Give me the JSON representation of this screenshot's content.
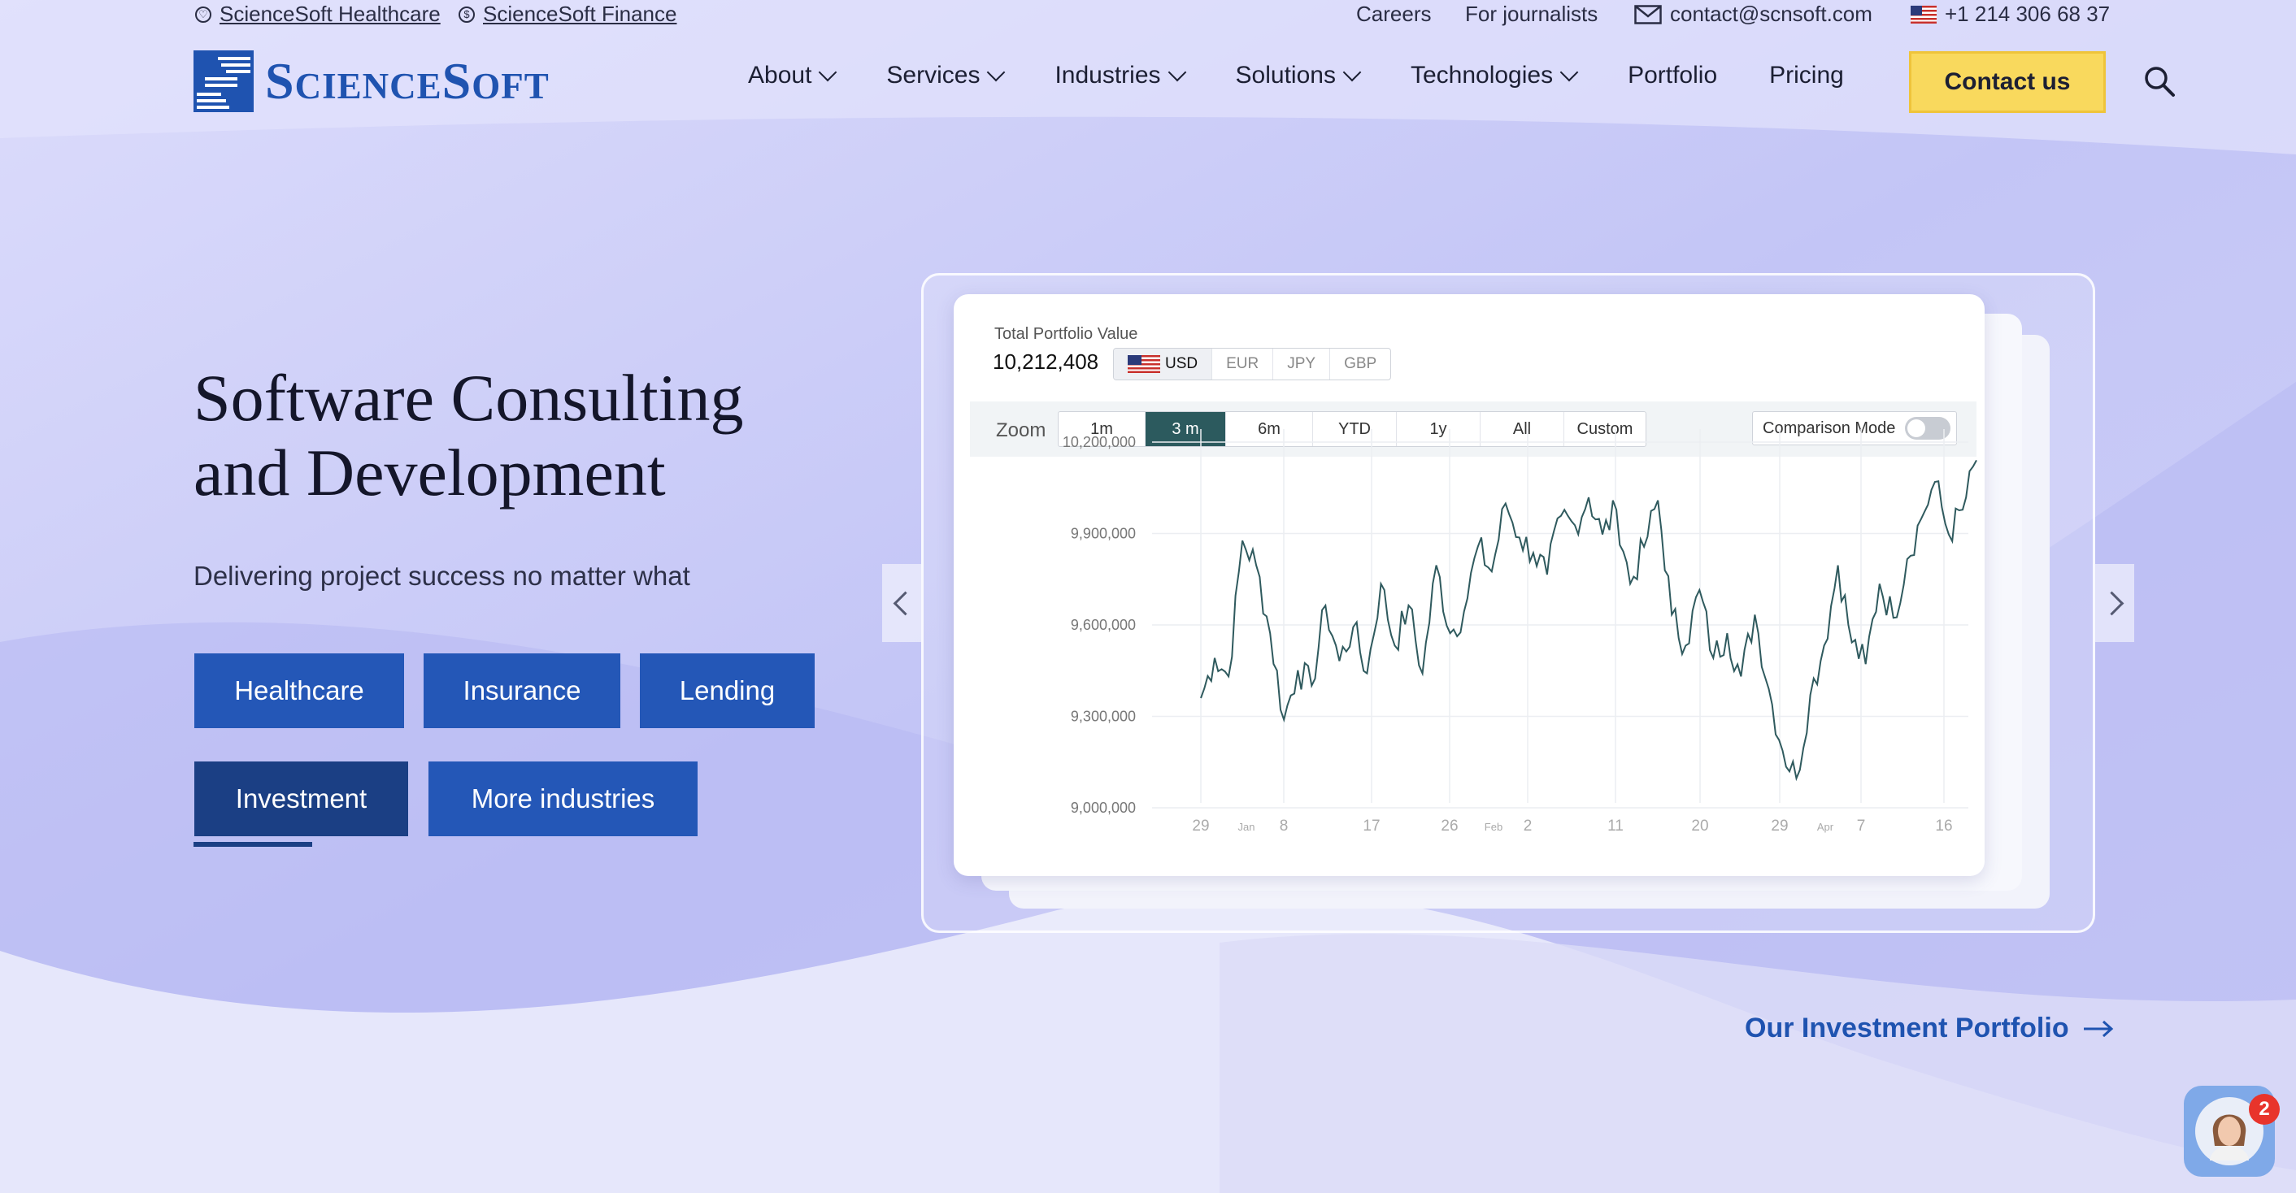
{
  "topbar": {
    "healthcare_link": "ScienceSoft Healthcare",
    "finance_link": "ScienceSoft Finance",
    "careers": "Careers",
    "journalists": "For journalists",
    "email": "contact@scnsoft.com",
    "phone": "+1 214 306 68 37"
  },
  "logo": {
    "text": "ScienceSoft"
  },
  "nav": {
    "items": [
      "About",
      "Services",
      "Industries",
      "Solutions",
      "Technologies",
      "Portfolio",
      "Pricing"
    ],
    "contact": "Contact us"
  },
  "hero": {
    "title_line1": "Software Consulting",
    "title_line2": "and Development",
    "subtitle": "Delivering project success no matter what",
    "buttons": [
      "Healthcare",
      "Insurance",
      "Lending",
      "Investment",
      "More industries"
    ],
    "active_button": "Investment"
  },
  "widget": {
    "label": "Total Portfolio Value",
    "value": "10,212,408",
    "currencies": [
      "USD",
      "EUR",
      "JPY",
      "GBP"
    ],
    "selected_currency": "USD",
    "zoom_label": "Zoom",
    "zoom_options": [
      "1m",
      "3 m",
      "6m",
      "YTD",
      "1y",
      "All",
      "Custom"
    ],
    "selected_zoom": "3 m",
    "comparison_label": "Comparison Mode"
  },
  "chart_data": {
    "type": "line",
    "y_ticks": [
      "10,200,000",
      "9,900,000",
      "9,600,000",
      "9,300,000",
      "9,000,000"
    ],
    "x_ticks": [
      {
        "label": "29",
        "minor": false
      },
      {
        "label": "Jan",
        "minor": true
      },
      {
        "label": "8",
        "minor": false
      },
      {
        "label": "17",
        "minor": false
      },
      {
        "label": "26",
        "minor": false
      },
      {
        "label": "Feb",
        "minor": true
      },
      {
        "label": "2",
        "minor": false
      },
      {
        "label": "11",
        "minor": false
      },
      {
        "label": "20",
        "minor": false
      },
      {
        "label": "29",
        "minor": false
      },
      {
        "label": "Apr",
        "minor": true
      },
      {
        "label": "7",
        "minor": false
      },
      {
        "label": "16",
        "minor": false
      }
    ],
    "ylim": [
      9000000,
      10200000
    ],
    "series": [
      {
        "values": [
          9350000,
          9480000,
          9420000,
          9860000,
          9780000,
          9560000,
          9280000,
          9440000,
          9390000,
          9650000,
          9470000,
          9580000,
          9430000,
          9720000,
          9520000,
          9650000,
          9430000,
          9780000,
          9560000,
          9630000,
          9840000,
          9760000,
          9980000,
          9870000,
          9820000,
          9750000,
          9940000,
          9910000,
          10000000,
          9880000,
          9960000,
          9720000,
          9840000,
          9990000,
          9620000,
          9520000,
          9700000,
          9480000,
          9560000,
          9420000,
          9620000,
          9380000,
          9180000,
          9090000,
          9360000,
          9520000,
          9780000,
          9530000,
          9460000,
          9720000,
          9610000,
          9800000,
          9930000,
          10050000,
          9880000,
          9960000,
          10120000
        ]
      }
    ]
  },
  "cta": {
    "portfolio_link": "Our Investment Portfolio"
  },
  "chat": {
    "badge": "2"
  }
}
